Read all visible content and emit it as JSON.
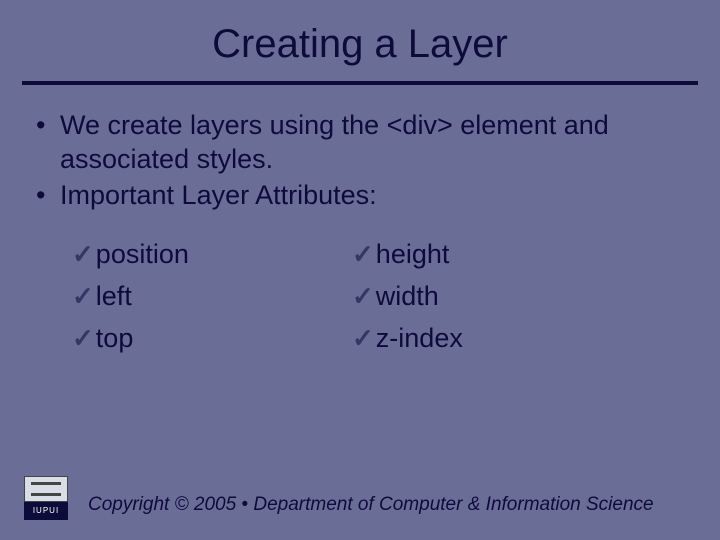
{
  "title": "Creating a Layer",
  "bullets": [
    "We create layers using the <div> element and associated styles.",
    "Important Layer Attributes:"
  ],
  "checks_left": [
    "position",
    "left",
    "top"
  ],
  "checks_right": [
    "height",
    "width",
    "z-index"
  ],
  "logo_text": "IUPUI",
  "copyright": "Copyright © 2005 • Department of Computer & Information Science"
}
